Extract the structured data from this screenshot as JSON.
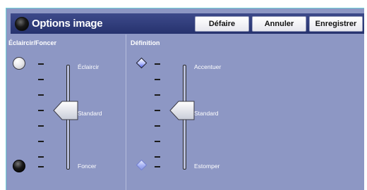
{
  "header": {
    "title": "Options image",
    "undo_label": "Défaire",
    "cancel_label": "Annuler",
    "save_label": "Enregistrer"
  },
  "lighten_darken": {
    "title": "Éclaircir/Foncer",
    "top_label": "Éclaircir",
    "middle_label": "Standard",
    "bottom_label": "Foncer",
    "top_icon": "light-circle-icon",
    "bottom_icon": "dark-circle-icon",
    "level": "Standard"
  },
  "sharpness": {
    "title": "Définition",
    "top_label": "Accentuer",
    "middle_label": "Standard",
    "bottom_label": "Estomper",
    "top_icon": "sharp-diamond-icon",
    "bottom_icon": "soft-diamond-icon",
    "level": "Standard"
  },
  "colors": {
    "panel_background": "#8d97c4",
    "header_background": "#2c387a",
    "border_accent": "#6fd0d8"
  }
}
